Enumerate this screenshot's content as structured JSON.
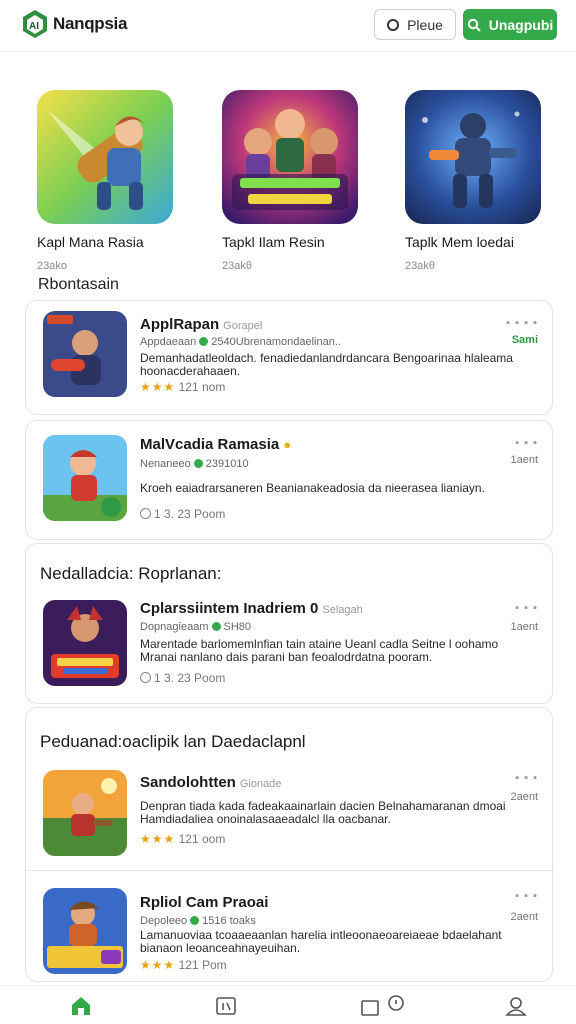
{
  "header": {
    "brand": "Nanqpsia",
    "search_label": "Pleue",
    "login_label": "Unagpubi"
  },
  "featured": [
    {
      "title": "Kapl Mana Rasia",
      "meta": "23ako"
    },
    {
      "title": "Tapkl Ilam Resin",
      "meta": "23akθ"
    },
    {
      "title": "Taplk Mem loedai",
      "meta": "23akθ"
    }
  ],
  "section_title": "Rbontasain",
  "list": {
    "card1": [
      {
        "title": "ApplRapan",
        "subtitle": "Gorapel",
        "meta_a": "Appdaeaan",
        "meta_b": "2540Ubrenamondaelinan..",
        "description": "Demanhadatleoldach. fenadiedanlandrdancara Bengoarinaa hlaleama hoonacderahaaen.",
        "rating_text": "121 nom",
        "side_top": "▪ ▪ ▪ ▪",
        "side_bottom": "Sami"
      },
      {
        "title": "MalVcadia Ramasia",
        "subtitle": "",
        "meta_a": "Nenaneeo",
        "meta_b": "2391010",
        "description": "Kroeh eaiadrarsaneren Beanianakeadosia da nieerasea lianiayn.",
        "rating_text": "1 3. 23 Poom",
        "side_top": "▪ ▪ ▪",
        "side_bottom": "1aent"
      }
    ],
    "card2": {
      "heading": "Nedalladcia: Roprlanan:",
      "row": {
        "title": "Cplarssiintem Inadriem 0",
        "subtitle": "Selagah",
        "meta_a": "Dopnagieaam",
        "meta_b": "SH80",
        "description": "Marentade barlomemlnfian tain ataine Ueanl cadla Seitne l oohamo Mranai nanlano dais parani ban feoalodrdatna pooram.",
        "rating_text": "1 3. 23 Poom",
        "side_top": "▪ ▪ ▪",
        "side_bottom": "1aent"
      }
    },
    "card3": {
      "heading": "Peduanad:oaclipik lan Daedaclapnl",
      "rows": [
        {
          "title": "Sandolohtten",
          "subtitle": "Gionade",
          "meta_a": "",
          "meta_b": "",
          "description": "Denpran tiada kada fadeakaainarlain dacien Belnahamaranan dmoai Hamdiadaliea onoinalasaaeadalcl lla oacbanar.",
          "rating_text": "121 oom",
          "side_top": "▪ ▪ ▪",
          "side_bottom": "2aent"
        },
        {
          "title": "Rpliol Cam Praoai",
          "subtitle": "",
          "meta_a": "Depoleeo",
          "meta_b": "1516 toaks",
          "description": "Lamanuoviaa tcoaaeaanlan harelia intleoonaeoareiaeae bdaelahant bianaon leoanceahnayeuihan.",
          "rating_text": "121 Pom",
          "side_top": "▪ ▪ ▪",
          "side_bottom": "2aent"
        }
      ]
    }
  },
  "bottom_nav": [
    "home",
    "library",
    "chat",
    "profile"
  ],
  "colors": {
    "accent": "#34a94a",
    "star": "#e8a317"
  }
}
